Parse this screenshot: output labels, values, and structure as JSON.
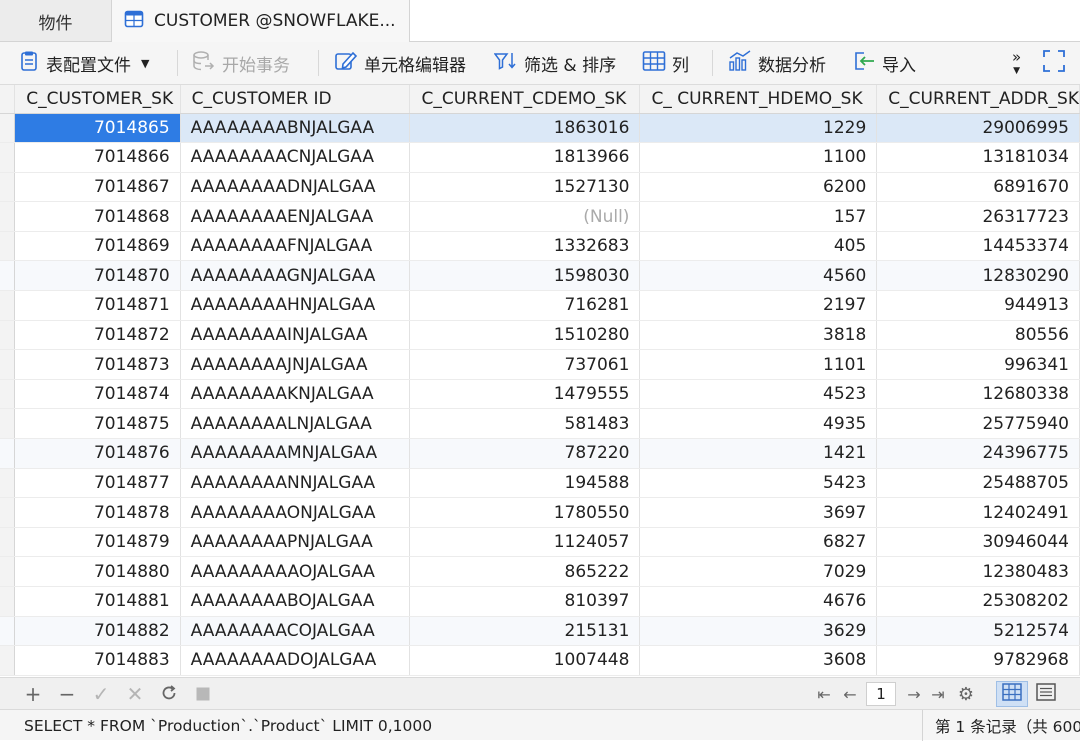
{
  "tabs": {
    "objects_label": "物件",
    "customer_label": "CUSTOMER @SNOWFLAKE..."
  },
  "toolbar": {
    "table_config_label": "表配置文件",
    "begin_transaction_label": "开始事务",
    "cell_editor_label": "单元格编辑器",
    "filter_sort_label": "筛选 & 排序",
    "columns_label": "列",
    "data_analysis_label": "数据分析",
    "import_label": "导入",
    "overflow_label": "»"
  },
  "grid": {
    "columns": [
      "C_CUSTOMER_SK",
      "C_CUSTOMER ID",
      "C_CURRENT_CDEMO_SK",
      "C_ CURRENT_HDEMO_SK",
      "C_CURRENT_ADDR_SK"
    ],
    "rows": [
      [
        "7014865",
        "AAAAAAAABNJALGAA",
        "1863016",
        "1229",
        "29006995"
      ],
      [
        "7014866",
        "AAAAAAAACNJALGAA",
        "1813966",
        "1100",
        "13181034"
      ],
      [
        "7014867",
        "AAAAAAAADNJALGAA",
        "1527130",
        "6200",
        "6891670"
      ],
      [
        "7014868",
        "AAAAAAAAENJALGAA",
        "(Null)",
        "157",
        "26317723"
      ],
      [
        "7014869",
        "AAAAAAAAFNJALGAA",
        "1332683",
        "405",
        "14453374"
      ],
      [
        "7014870",
        "AAAAAAAAGNJALGAA",
        "1598030",
        "4560",
        "12830290"
      ],
      [
        "7014871",
        "AAAAAAAAHNJALGAA",
        "716281",
        "2197",
        "944913"
      ],
      [
        "7014872",
        "AAAAAAAAINJALGAA",
        "1510280",
        "3818",
        "80556"
      ],
      [
        "7014873",
        "AAAAAAAAJNJALGAA",
        "737061",
        "1101",
        "996341"
      ],
      [
        "7014874",
        "AAAAAAAAKNJALGAA",
        "1479555",
        "4523",
        "12680338"
      ],
      [
        "7014875",
        "AAAAAAAALNJALGAA",
        "581483",
        "4935",
        "25775940"
      ],
      [
        "7014876",
        "AAAAAAAAMNJALGAA",
        "787220",
        "1421",
        "24396775"
      ],
      [
        "7014877",
        "AAAAAAAANNJALGAA",
        "194588",
        "5423",
        "25488705"
      ],
      [
        "7014878",
        "AAAAAAAAONJALGAA",
        "1780550",
        "3697",
        "12402491"
      ],
      [
        "7014879",
        "AAAAAAAAPNJALGAA",
        "1124057",
        "6827",
        "30946044"
      ],
      [
        "7014880",
        "AAAAAAAAAOJALGAA",
        "865222",
        "7029",
        "12380483"
      ],
      [
        "7014881",
        "AAAAAAAABOJALGAA",
        "810397",
        "4676",
        "25308202"
      ],
      [
        "7014882",
        "AAAAAAAACOJALGAA",
        "215131",
        "3629",
        "5212574"
      ],
      [
        "7014883",
        "AAAAAAAADOJALGAA",
        "1007448",
        "3608",
        "9782968"
      ]
    ]
  },
  "bottombar": {
    "page_number": "1"
  },
  "status": {
    "sql_text": "SELECT * FROM `Production`.`Product` LIMIT 0,1000",
    "record_text": "第 1 条记录（共 600"
  },
  "colors": {
    "accent": "#2e7ce4",
    "selected_row": "#dbe8f7",
    "icon_blue": "#2e6fd6"
  }
}
